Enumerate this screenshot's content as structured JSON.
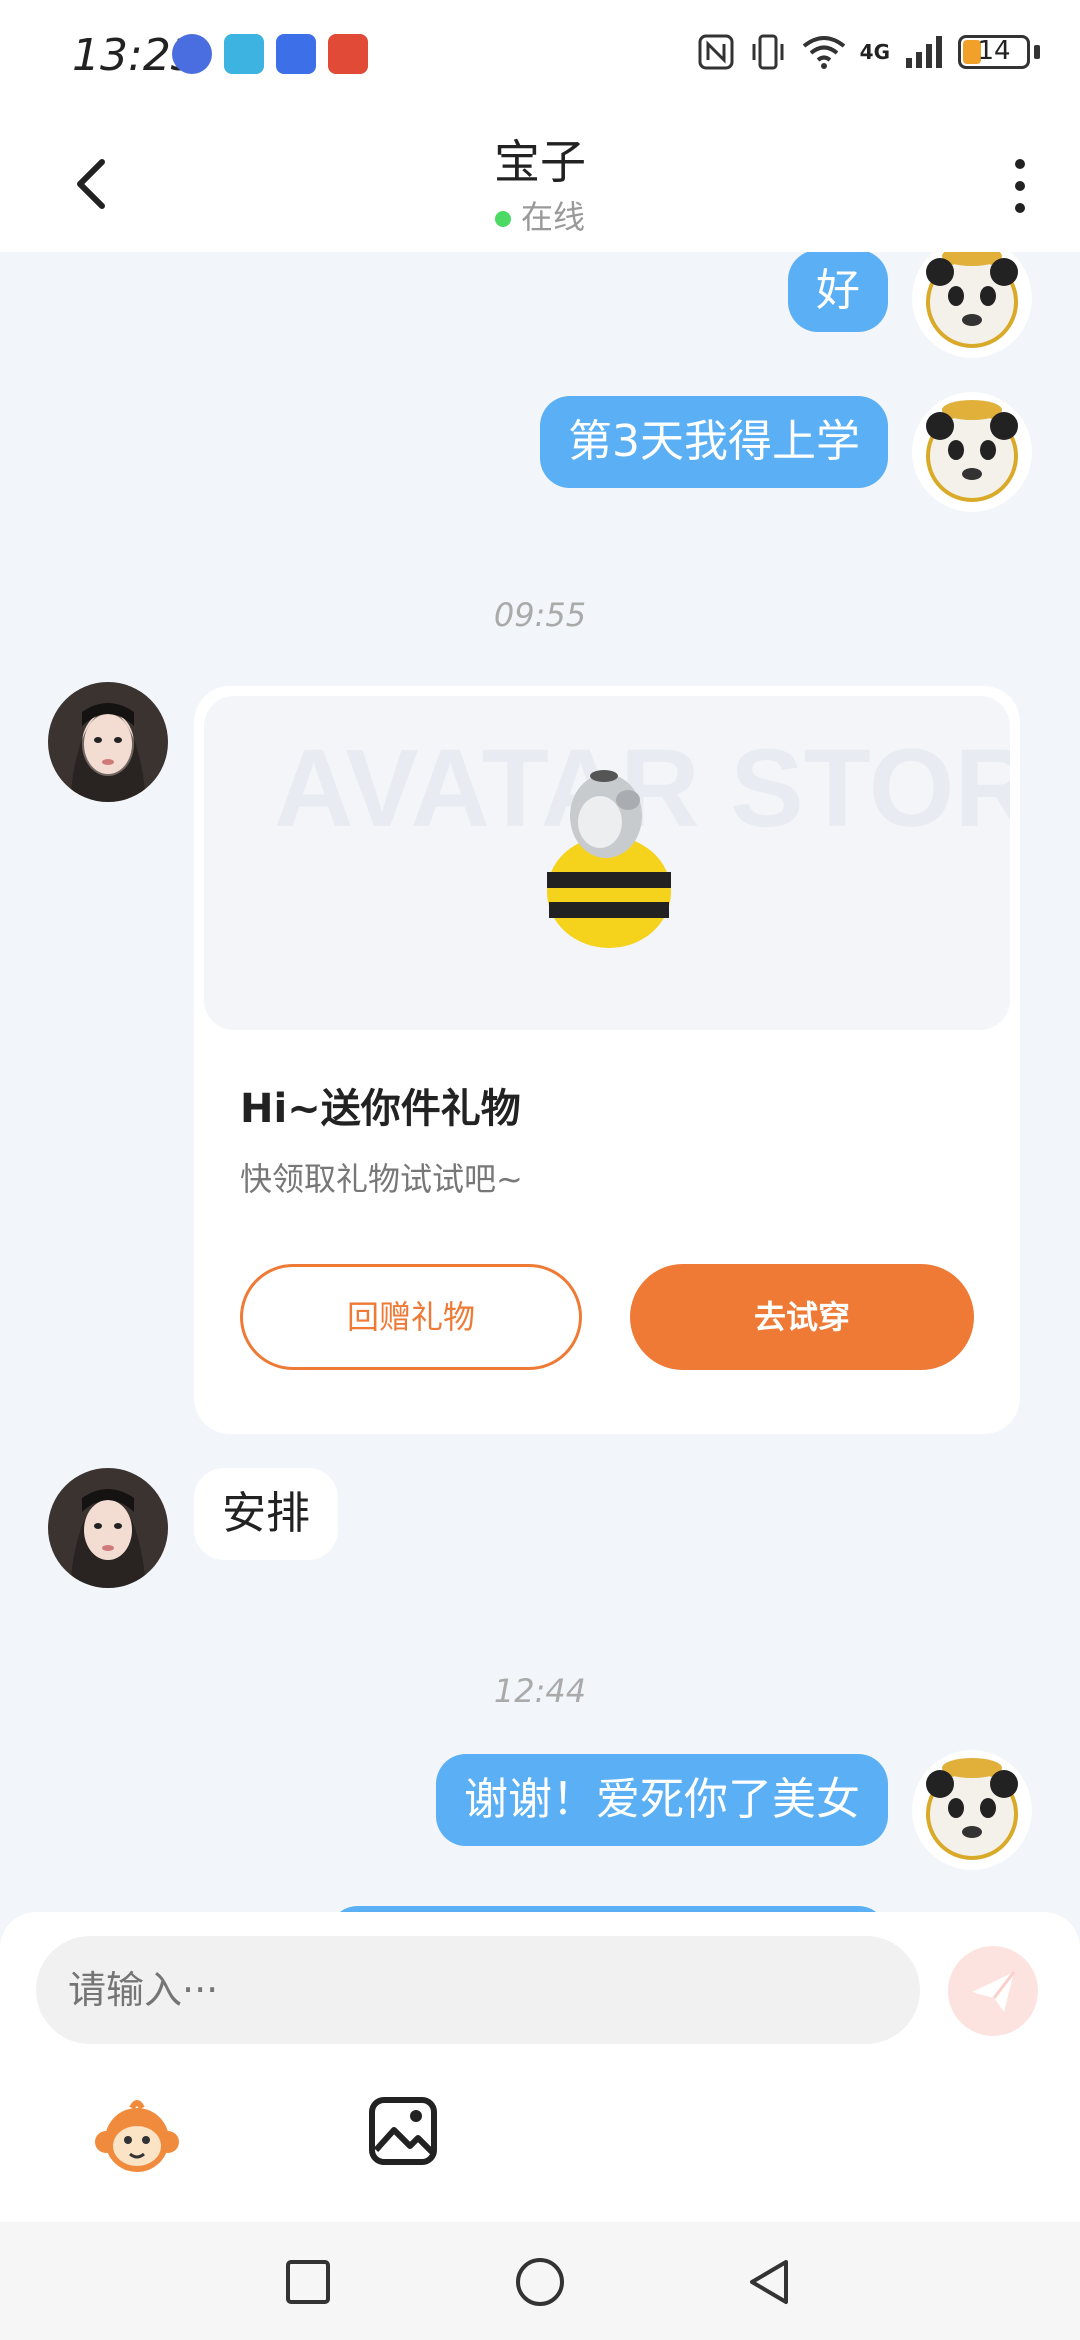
{
  "status_bar": {
    "time": "13:23",
    "battery": "14",
    "network": "4G",
    "icons": [
      "browser-icon",
      "book-app-icon",
      "store-app-icon",
      "video-app-icon",
      "nfc-icon",
      "vibrate-icon",
      "wifi-icon",
      "signal-icon",
      "battery-icon"
    ]
  },
  "header": {
    "title": "宝子",
    "status": "在线"
  },
  "messages": {
    "m1": "好",
    "m2": "第3天我得上学",
    "ts1": "09:55",
    "gift": {
      "title": "Hi~送你件礼物",
      "subtitle": "快领取礼物试试吧~",
      "return_button": "回赠礼物",
      "try_button": "去试穿",
      "image_watermark": "AVATAR STORE"
    },
    "m3": "安排",
    "ts2": "12:44",
    "m4": "谢谢！爱死你了美女"
  },
  "input": {
    "placeholder": "请输入···"
  },
  "colors": {
    "my_bubble": "#5aaff5",
    "accent": "#ee7a36",
    "online": "#4cd964",
    "send": "#fde3e0"
  }
}
